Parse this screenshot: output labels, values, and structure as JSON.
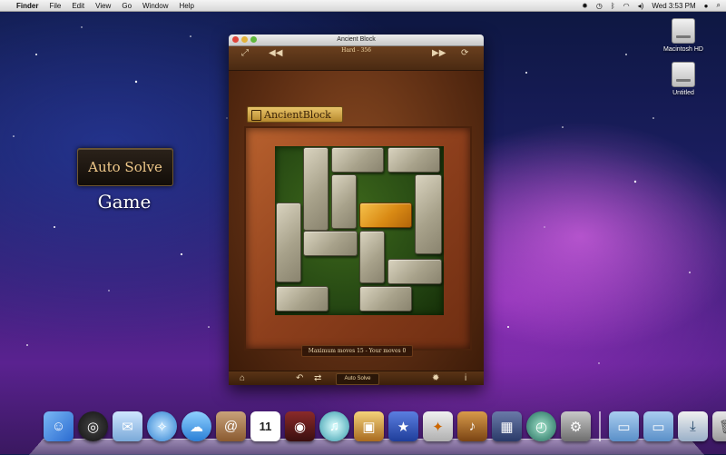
{
  "menubar": {
    "app_name": "Finder",
    "menus": [
      "File",
      "Edit",
      "View",
      "Go",
      "Window",
      "Help"
    ],
    "clock": "Wed 3:53 PM"
  },
  "desktop": {
    "icons": [
      {
        "label": "Macintosh HD"
      },
      {
        "label": "Untitled"
      }
    ]
  },
  "promo": {
    "button_label": "Auto Solve",
    "caption": "Game"
  },
  "window": {
    "title": "Ancient Block",
    "level_label": "Hard - 356",
    "logo_text": "AncientBlock",
    "info_text": "Maximum moves 15 - Your moves 0",
    "auto_solve_label": "Auto Solve",
    "accent_colors": {
      "target": "#d98a14",
      "stone": "#a8a28b",
      "moss": "#2f5518"
    }
  },
  "board": {
    "size_cells": 6,
    "target_block": {
      "row": 2,
      "col": 3,
      "orientation": "horizontal",
      "length": 2
    }
  },
  "dock": {
    "apps": [
      "finder-icon",
      "dashboard-icon",
      "mail-icon",
      "safari-icon",
      "ichat-icon",
      "address-book-icon",
      "ical-icon",
      "photo-booth-icon",
      "itunes-icon",
      "iphoto-icon",
      "imovie-icon",
      "iweb-icon",
      "garageband-icon",
      "spaces-icon",
      "time-machine-icon",
      "system-preferences-icon",
      "applications-folder-icon",
      "documents-folder-icon",
      "downloads-stack-icon",
      "trash-icon"
    ],
    "ical_day": "11"
  }
}
